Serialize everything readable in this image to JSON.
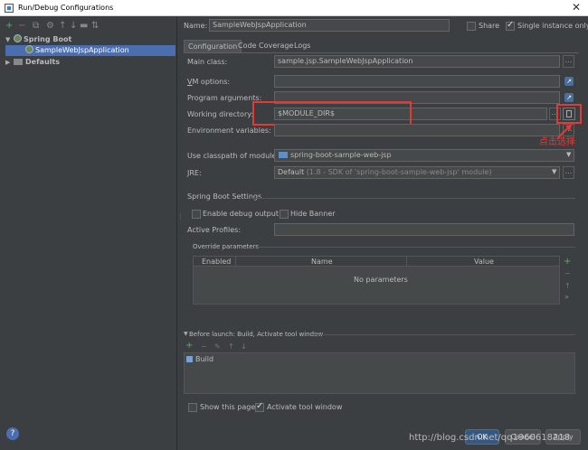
{
  "window": {
    "title": "Run/Debug Configurations",
    "close_glyph": "✕"
  },
  "toolbar_left": {
    "add": "+",
    "remove": "−"
  },
  "tree": {
    "group": "Spring Boot",
    "item": "SampleWebJspApplication",
    "defaults": "Defaults"
  },
  "header": {
    "name_label": "Name:",
    "name_value": "SampleWebJspApplication",
    "share_label": "Share",
    "single_instance_label": "Single instance only"
  },
  "tabs": [
    "Configuration",
    "Code Coverage",
    "Logs"
  ],
  "form": {
    "main_class_label": "Main class:",
    "main_class_value": "sample.jsp.SampleWebJspApplication",
    "vm_options_label": "VM options:",
    "program_args_label": "Program arguments:",
    "working_dir_label": "Working directory:",
    "working_dir_value": "$MODULE_DIR$",
    "env_vars_label": "Environment variables:",
    "classpath_label": "Use classpath of module:",
    "classpath_value": "spring-boot-sample-web-jsp",
    "jre_label": "JRE:",
    "jre_value": "Default",
    "jre_detail": "(1.8 - SDK of 'spring-boot-sample-web-jsp' module)"
  },
  "spring_boot": {
    "section_label": "Spring Boot Settings",
    "debug_output_label": "Enable debug output",
    "hide_banner_label": "Hide Banner",
    "active_profiles_label": "Active Profiles:",
    "override_label": "Override parameters",
    "columns": [
      "Enabled",
      "Name",
      "Value"
    ],
    "empty_text": "No parameters"
  },
  "before_launch": {
    "label": "Before launch: Build, Activate tool window",
    "task": "Build"
  },
  "footer": {
    "show_page_label": "Show this page",
    "activate_window_label": "Activate tool window",
    "ok": "OK",
    "cancel": "Cancel",
    "apply": "Apply",
    "help": "?"
  },
  "annotation": {
    "text": "点击选择",
    "color": "#e53935"
  },
  "watermark": "http://blog.csdn.net/qq1960618218",
  "colors": {
    "background": "#3c3f41",
    "selection": "#4b6eaf",
    "annotation_red": "#e53935"
  }
}
